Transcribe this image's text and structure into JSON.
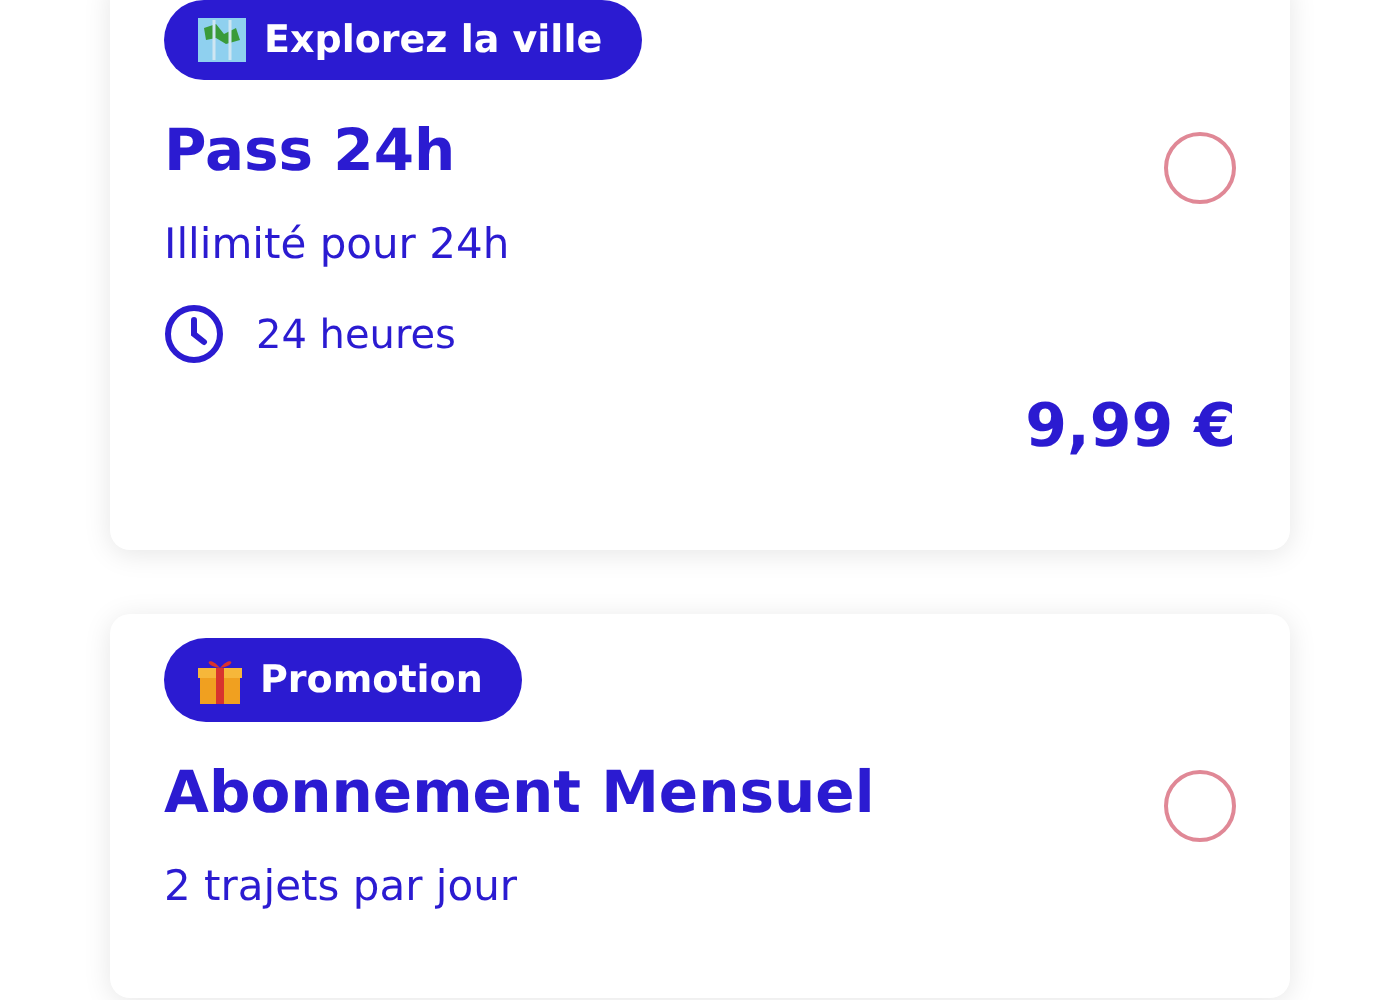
{
  "offers": [
    {
      "badge": "Explorez la ville",
      "title": "Pass 24h",
      "description": "Illimité pour 24h",
      "duration": "24 heures",
      "price": "9,99 €",
      "selected": false
    },
    {
      "badge": "Promotion",
      "title": "Abonnement Mensuel",
      "description": "2 trajets par jour",
      "selected": false
    }
  ]
}
